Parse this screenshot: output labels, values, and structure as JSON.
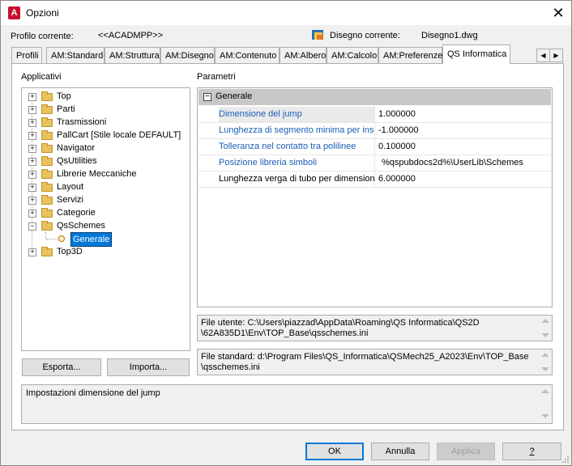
{
  "window": {
    "title": "Opzioni",
    "app_icon": "A"
  },
  "header": {
    "profile_label": "Profilo corrente:",
    "profile_value": "<<ACADMPP>>",
    "drawing_label": "Disegno corrente:",
    "drawing_value": "Disegno1.dwg"
  },
  "tabs": [
    "Profili",
    "AM:Standard",
    "AM:Struttura",
    "AM:Disegno",
    "AM:Contenuto",
    "AM:Albero",
    "AM:Calcolo",
    "AM:Preferenze",
    "QS Informatica"
  ],
  "left": {
    "label": "Applicativi",
    "tree": [
      "Top",
      "Parti",
      "Trasmissioni",
      "PallCart [Stile locale DEFAULT]",
      "Navigator",
      "QsUtilities",
      "Librerie Meccaniche",
      "Layout",
      "Servizi",
      "Categorie",
      "QsSchemes",
      "Generale",
      "Top3D"
    ],
    "export_button": "Esporta...",
    "import_button": "Importa..."
  },
  "right": {
    "label": "Parametri",
    "group": "Generale",
    "rows": [
      {
        "name": "Dimensione del jump",
        "value": "1.000000"
      },
      {
        "name": "Lunghezza di segmento minima per inser",
        "value": "-1.000000"
      },
      {
        "name": "Tolleranza nel contatto tra polilinee",
        "value": "0.100000"
      },
      {
        "name": "Posizione libreria simboli",
        "value": "%qspubdocs2d%\\UserLib\\Schemes"
      },
      {
        "name": "Lunghezza verga di tubo per dimensiona",
        "value": "6.000000"
      }
    ]
  },
  "file_user": {
    "line1": "File utente: C:\\Users\\piazzad\\AppData\\Roaming\\QS Informatica\\QS2D",
    "line2": "\\62A835D1\\Env\\TOP_Base\\qsschemes.ini"
  },
  "file_standard": {
    "line1": "File standard: d:\\Program Files\\QS_Informatica\\QSMech25_A2023\\Env\\TOP_Base",
    "line2": "\\qsschemes.ini"
  },
  "description": "Impostazioni dimensione del jump",
  "buttons": {
    "ok": "OK",
    "cancel": "Annulla",
    "apply": "Applica",
    "help": "?"
  }
}
